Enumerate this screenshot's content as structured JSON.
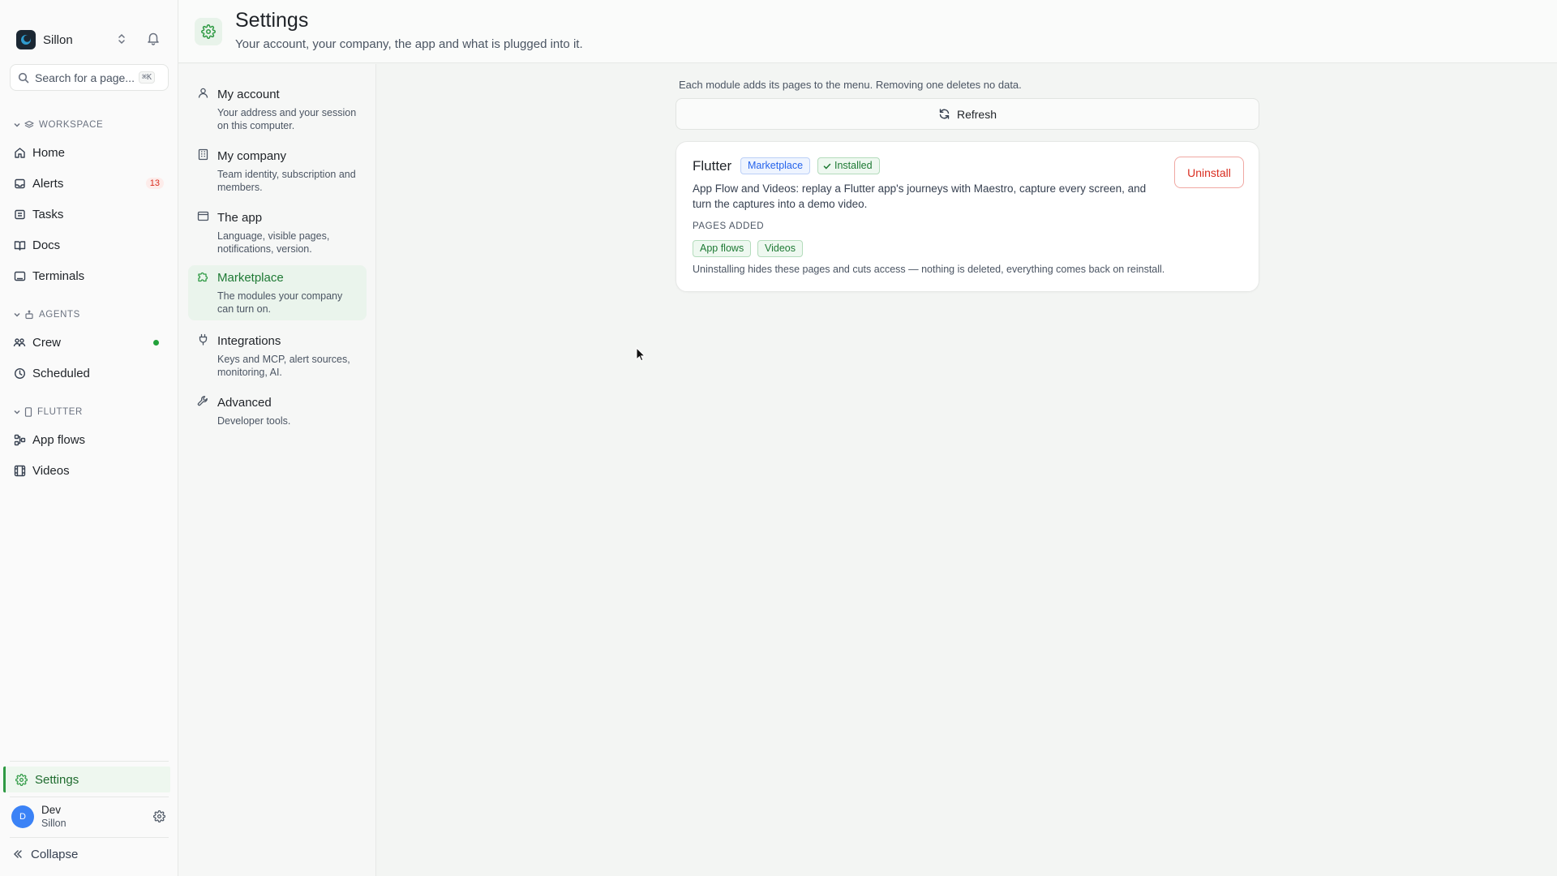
{
  "app": {
    "brand_name": "Sillon",
    "search": {
      "placeholder": "Search for a page...",
      "shortcut": "⌘K"
    }
  },
  "sidebar": {
    "sections": [
      {
        "label": "WORKSPACE",
        "items": [
          {
            "label": "Home",
            "icon": "home-icon"
          },
          {
            "label": "Alerts",
            "icon": "inbox-icon",
            "badge": "13"
          },
          {
            "label": "Tasks",
            "icon": "tasks-icon"
          },
          {
            "label": "Docs",
            "icon": "book-icon"
          },
          {
            "label": "Terminals",
            "icon": "terminal-icon"
          }
        ]
      },
      {
        "label": "AGENTS",
        "items": [
          {
            "label": "Crew",
            "icon": "users-icon",
            "status": "online"
          },
          {
            "label": "Scheduled",
            "icon": "clock-icon"
          }
        ]
      },
      {
        "label": "FLUTTER",
        "items": [
          {
            "label": "App flows",
            "icon": "flow-icon"
          },
          {
            "label": "Videos",
            "icon": "film-icon"
          }
        ]
      }
    ],
    "settings_label": "Settings",
    "user": {
      "initial": "D",
      "name": "Dev",
      "org": "Sillon"
    },
    "collapse_label": "Collapse",
    "colors": {
      "accent": "#2f9a44",
      "badge": "#d92d20",
      "avatar": "#3b82f6"
    }
  },
  "header": {
    "title": "Settings",
    "subtitle": "Your account, your company, the app and what is plugged into it."
  },
  "settings_nav": [
    {
      "title": "My account",
      "desc": "Your address and your session on this computer.",
      "icon": "user-icon"
    },
    {
      "title": "My company",
      "desc": "Team identity, subscription and members.",
      "icon": "building-icon"
    },
    {
      "title": "The app",
      "desc": "Language, visible pages, notifications, version.",
      "icon": "window-icon"
    },
    {
      "title": "Marketplace",
      "desc": "The modules your company can turn on.",
      "icon": "puzzle-icon",
      "active": true
    },
    {
      "title": "Integrations",
      "desc": "Keys and MCP, alert sources, monitoring, AI.",
      "icon": "plug-icon"
    },
    {
      "title": "Advanced",
      "desc": "Developer tools.",
      "icon": "wrench-icon"
    }
  ],
  "marketplace": {
    "hint": "Each module adds its pages to the menu. Removing one deletes no data.",
    "refresh_label": "Refresh",
    "modules": [
      {
        "name": "Flutter",
        "source_badge": "Marketplace",
        "status_badge": "Installed",
        "description": "App Flow and Videos: replay a Flutter app's journeys with Maestro, capture every screen, and turn the captures into a demo video.",
        "pages_label": "PAGES ADDED",
        "pages": [
          "App flows",
          "Videos"
        ],
        "note": "Uninstalling hides these pages and cuts access — nothing is deleted, everything comes back on reinstall.",
        "action_label": "Uninstall"
      }
    ]
  }
}
